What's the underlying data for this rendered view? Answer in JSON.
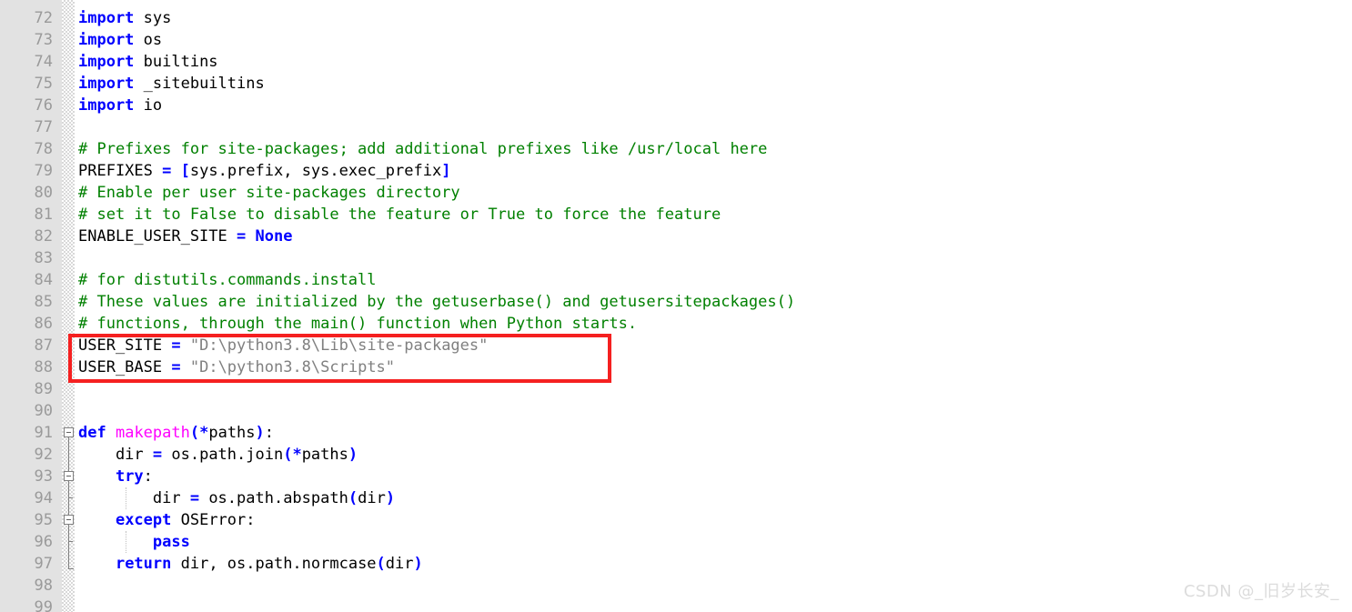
{
  "editor": {
    "kind": "code-editor",
    "language": "python",
    "gutter_bg": "#e2e2e2",
    "code_bg": "#ffffff",
    "first_visible_line": 72,
    "last_visible_line": 99,
    "line_height_px": 24,
    "colors": {
      "keyword": "#0000ff",
      "operator": "#0000ff",
      "comment": "#008000",
      "string": "#808080",
      "function": "#ff00ff",
      "plain": "#000000",
      "lineno": "#9a9a9a",
      "annotation": "#f52020",
      "watermark": "#dcdcdc"
    }
  },
  "lines": [
    {
      "n": "72",
      "tokens": [
        {
          "t": "kw",
          "v": "import"
        },
        {
          "t": "pln",
          "v": " sys"
        }
      ]
    },
    {
      "n": "73",
      "tokens": [
        {
          "t": "kw",
          "v": "import"
        },
        {
          "t": "pln",
          "v": " os"
        }
      ]
    },
    {
      "n": "74",
      "tokens": [
        {
          "t": "kw",
          "v": "import"
        },
        {
          "t": "pln",
          "v": " builtins"
        }
      ]
    },
    {
      "n": "75",
      "tokens": [
        {
          "t": "kw",
          "v": "import"
        },
        {
          "t": "pln",
          "v": " _sitebuiltins"
        }
      ]
    },
    {
      "n": "76",
      "tokens": [
        {
          "t": "kw",
          "v": "import"
        },
        {
          "t": "pln",
          "v": " io"
        }
      ]
    },
    {
      "n": "77",
      "tokens": []
    },
    {
      "n": "78",
      "tokens": [
        {
          "t": "cmt",
          "v": "# Prefixes for site-packages; add additional prefixes like /usr/local here"
        }
      ]
    },
    {
      "n": "79",
      "tokens": [
        {
          "t": "pln",
          "v": "PREFIXES "
        },
        {
          "t": "op",
          "v": "="
        },
        {
          "t": "pln",
          "v": " "
        },
        {
          "t": "op",
          "v": "["
        },
        {
          "t": "pln",
          "v": "sys.prefix, sys.exec_prefix"
        },
        {
          "t": "op",
          "v": "]"
        }
      ]
    },
    {
      "n": "80",
      "tokens": [
        {
          "t": "cmt",
          "v": "# Enable per user site-packages directory"
        }
      ]
    },
    {
      "n": "81",
      "tokens": [
        {
          "t": "cmt",
          "v": "# set it to False to disable the feature or True to force the feature"
        }
      ]
    },
    {
      "n": "82",
      "tokens": [
        {
          "t": "pln",
          "v": "ENABLE_USER_SITE "
        },
        {
          "t": "op",
          "v": "="
        },
        {
          "t": "pln",
          "v": " "
        },
        {
          "t": "kw",
          "v": "None"
        }
      ]
    },
    {
      "n": "83",
      "tokens": []
    },
    {
      "n": "84",
      "tokens": [
        {
          "t": "cmt",
          "v": "# for distutils.commands.install"
        }
      ]
    },
    {
      "n": "85",
      "tokens": [
        {
          "t": "cmt",
          "v": "# These values are initialized by the getuserbase() and getusersitepackages()"
        }
      ]
    },
    {
      "n": "86",
      "tokens": [
        {
          "t": "cmt",
          "v": "# functions, through the main() function when Python starts."
        }
      ]
    },
    {
      "n": "87",
      "tokens": [
        {
          "t": "pln",
          "v": "USER_SITE "
        },
        {
          "t": "op",
          "v": "="
        },
        {
          "t": "pln",
          "v": " "
        },
        {
          "t": "str",
          "v": "\"D:\\python3.8\\Lib\\site-packages\""
        }
      ]
    },
    {
      "n": "88",
      "tokens": [
        {
          "t": "pln",
          "v": "USER_BASE "
        },
        {
          "t": "op",
          "v": "="
        },
        {
          "t": "pln",
          "v": " "
        },
        {
          "t": "str",
          "v": "\"D:\\python3.8\\Scripts\""
        }
      ]
    },
    {
      "n": "89",
      "tokens": []
    },
    {
      "n": "90",
      "tokens": []
    },
    {
      "n": "91",
      "tokens": [
        {
          "t": "kw",
          "v": "def"
        },
        {
          "t": "pln",
          "v": " "
        },
        {
          "t": "fn",
          "v": "makepath"
        },
        {
          "t": "op",
          "v": "(*"
        },
        {
          "t": "pln",
          "v": "paths"
        },
        {
          "t": "op",
          "v": ")"
        },
        {
          "t": "pln",
          "v": ":"
        }
      ]
    },
    {
      "n": "92",
      "tokens": [
        {
          "t": "pln",
          "v": "    dir "
        },
        {
          "t": "op",
          "v": "="
        },
        {
          "t": "pln",
          "v": " os.path.join"
        },
        {
          "t": "op",
          "v": "(*"
        },
        {
          "t": "pln",
          "v": "paths"
        },
        {
          "t": "op",
          "v": ")"
        }
      ]
    },
    {
      "n": "93",
      "tokens": [
        {
          "t": "pln",
          "v": "    "
        },
        {
          "t": "kw",
          "v": "try"
        },
        {
          "t": "pln",
          "v": ":"
        }
      ]
    },
    {
      "n": "94",
      "tokens": [
        {
          "t": "pln",
          "v": "        dir "
        },
        {
          "t": "op",
          "v": "="
        },
        {
          "t": "pln",
          "v": " os.path.abspath"
        },
        {
          "t": "op",
          "v": "("
        },
        {
          "t": "pln",
          "v": "dir"
        },
        {
          "t": "op",
          "v": ")"
        }
      ]
    },
    {
      "n": "95",
      "tokens": [
        {
          "t": "pln",
          "v": "    "
        },
        {
          "t": "kw",
          "v": "except"
        },
        {
          "t": "pln",
          "v": " OSError:"
        }
      ]
    },
    {
      "n": "96",
      "tokens": [
        {
          "t": "pln",
          "v": "        "
        },
        {
          "t": "kw",
          "v": "pass"
        }
      ]
    },
    {
      "n": "97",
      "tokens": [
        {
          "t": "pln",
          "v": "    "
        },
        {
          "t": "kw",
          "v": "return"
        },
        {
          "t": "pln",
          "v": " dir, os.path.normcase"
        },
        {
          "t": "op",
          "v": "("
        },
        {
          "t": "pln",
          "v": "dir"
        },
        {
          "t": "op",
          "v": ")"
        }
      ]
    },
    {
      "n": "98",
      "tokens": []
    },
    {
      "n": "99",
      "tokens": []
    }
  ],
  "fold_markers": [
    {
      "line": "91",
      "type": "collapse-box"
    },
    {
      "line": "92",
      "type": "connector"
    },
    {
      "line": "93",
      "type": "collapse-box"
    },
    {
      "line": "94",
      "type": "tick"
    },
    {
      "line": "95",
      "type": "collapse-box"
    },
    {
      "line": "96",
      "type": "tick"
    },
    {
      "line": "97",
      "type": "end"
    }
  ],
  "annotation": {
    "name": "red-highlight-rectangle",
    "color": "#f52020",
    "covers_lines": [
      "87",
      "88"
    ]
  },
  "watermark": {
    "text": "CSDN @_旧岁长安_"
  }
}
